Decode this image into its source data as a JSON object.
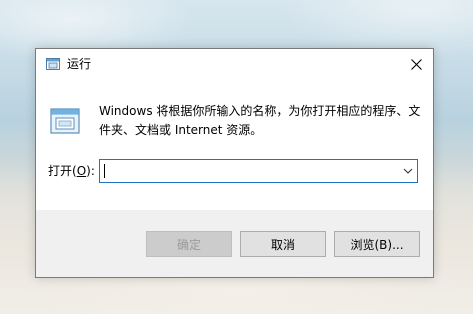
{
  "dialog": {
    "title": "运行",
    "description": "Windows 将根据你所输入的名称，为你打开相应的程序、文件夹、文档或 Internet 资源。",
    "open_label_prefix": "打开(",
    "open_label_key": "O",
    "open_label_suffix": "):",
    "open_value": "",
    "buttons": {
      "ok": "确定",
      "cancel": "取消",
      "browse": "浏览(B)..."
    }
  },
  "colors": {
    "focus_border": "#1c72c4",
    "dialog_bg": "#f0f0f0",
    "content_bg": "#ffffff"
  },
  "icons": {
    "title": "run-icon",
    "main": "run-icon",
    "close": "close-icon",
    "dropdown": "chevron-down-icon"
  }
}
